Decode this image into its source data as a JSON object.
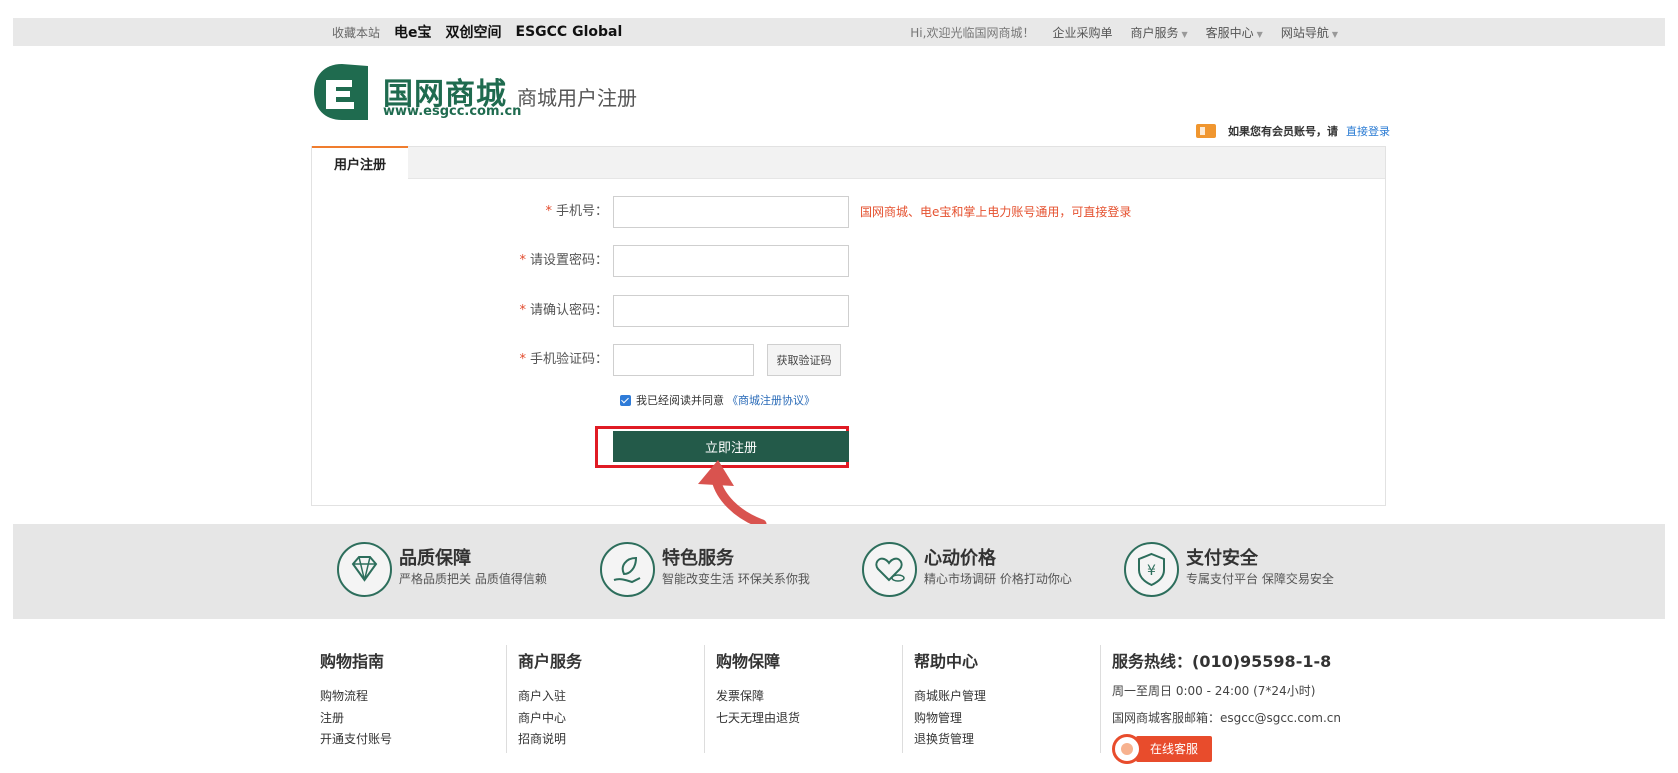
{
  "topbar": {
    "favorite": "收藏本站",
    "links": [
      "电e宝",
      "双创空间",
      "ESGCC Global"
    ],
    "welcome": "Hi,欢迎光临国网商城！",
    "nav": [
      {
        "label": "企业采购单",
        "caret": false
      },
      {
        "label": "商户服务",
        "caret": true
      },
      {
        "label": "客服中心",
        "caret": true
      },
      {
        "label": "网站导航",
        "caret": true
      }
    ]
  },
  "header": {
    "logo_text": "国网商城",
    "logo_url": "www.esgcc.com.cn",
    "subtitle": "商城用户注册",
    "login_hint": "如果您有会员账号，请",
    "login_link": "直接登录"
  },
  "form": {
    "tab": "用户注册",
    "required_mark": "*",
    "phone_label": "手机号：",
    "phone_note": "国网商城、电e宝和掌上电力账号通用，可直接登录",
    "password_label": "请设置密码：",
    "confirm_label": "请确认密码：",
    "code_label": "手机验证码：",
    "code_button": "获取验证码",
    "agree_text": "我已经阅读并同意",
    "agree_link": "《商城注册协议》",
    "submit": "立即注册"
  },
  "features": [
    {
      "title": "品质保障",
      "desc": "严格品质把关 品质值得信赖",
      "icon": "diamond-icon"
    },
    {
      "title": "特色服务",
      "desc": "智能改变生活 环保关系你我",
      "icon": "leaf-hand-icon"
    },
    {
      "title": "心动价格",
      "desc": "精心市场调研 价格打动你心",
      "icon": "heart-coin-icon"
    },
    {
      "title": "支付安全",
      "desc": "专属支付平台 保障交易安全",
      "icon": "yen-shield-icon"
    }
  ],
  "footer": {
    "columns": [
      {
        "title": "购物指南",
        "links": [
          "购物流程",
          "注册",
          "开通支付账号"
        ]
      },
      {
        "title": "商户服务",
        "links": [
          "商户入驻",
          "商户中心",
          "招商说明"
        ]
      },
      {
        "title": "购物保障",
        "links": [
          "发票保障",
          "七天无理由退货"
        ]
      },
      {
        "title": "帮助中心",
        "links": [
          "商城账户管理",
          "购物管理",
          "退换货管理"
        ]
      }
    ],
    "hotline": "服务热线：(010)95598-1-8",
    "hours": "周一至周日 0:00 - 24:00 (7*24小时)",
    "email": "国网商城客服邮箱：esgcc@sgcc.com.cn",
    "online": "在线客服"
  },
  "colors": {
    "brand": "#1f6b4f",
    "button": "#235a49",
    "accent": "#f07d2e",
    "highlight": "#e01b24",
    "note": "#e5512f"
  }
}
